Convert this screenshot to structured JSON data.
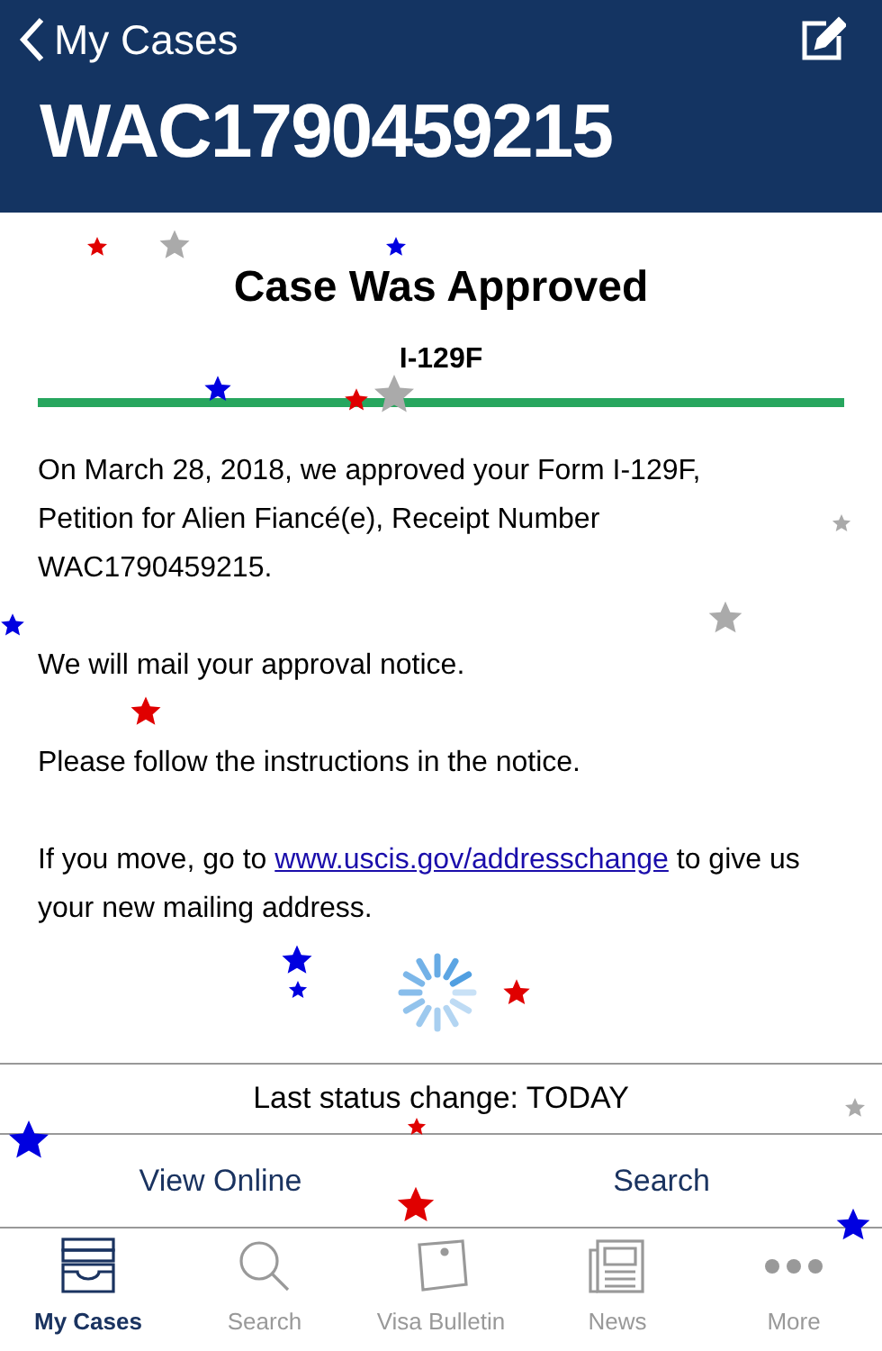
{
  "nav": {
    "back_label": "My Cases"
  },
  "case_number": "WAC1790459215",
  "status": {
    "title": "Case Was Approved",
    "form": "I-129F",
    "level": 1
  },
  "paragraphs": [
    {
      "kind": "text",
      "text": "On March 28, 2018, we approved your Form I-129F, Petition for Alien Fiancé(e), Receipt Number WAC1790459215."
    },
    {
      "kind": "text",
      "text": "We will mail your approval notice."
    },
    {
      "kind": "text",
      "text": "Please follow the instructions in the notice."
    },
    {
      "kind": "link",
      "before": "If you move, go to",
      "link": "www.uscis.gov/addresschange",
      "after": "to give us your new mailing address."
    }
  ],
  "last_status": "Last status change: TODAY",
  "actions": [
    "View Online",
    "Search"
  ],
  "tabs": [
    {
      "label": "My Cases",
      "selected": true
    },
    {
      "label": "Search",
      "selected": false
    },
    {
      "label": "Visa Bulletin",
      "selected": false
    },
    {
      "label": "News",
      "selected": false
    },
    {
      "label": "More",
      "selected": false
    }
  ]
}
